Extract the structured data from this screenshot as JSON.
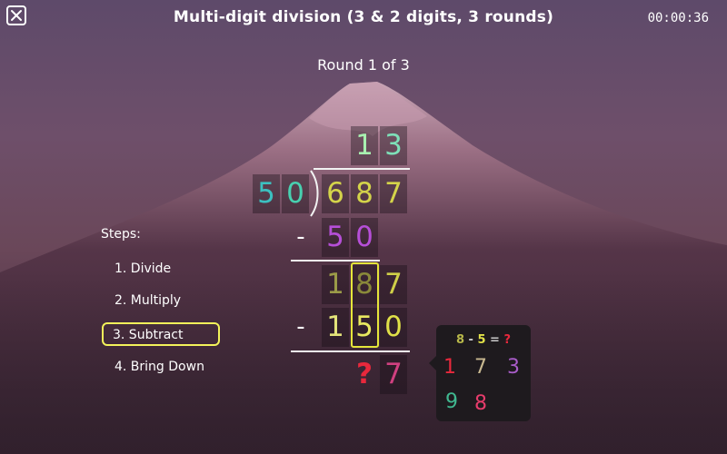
{
  "header": {
    "title": "Multi-digit division (3 & 2 digits, 3 rounds)",
    "timer": "00:00:36"
  },
  "round_label": "Round 1 of 3",
  "steps": {
    "title": "Steps:",
    "items": [
      "1. Divide",
      "2. Multiply",
      "3. Subtract",
      "4. Bring Down"
    ],
    "active_index": 2
  },
  "problem": {
    "quotient": [
      "1",
      "3"
    ],
    "divisor": [
      "5",
      "0"
    ],
    "dividend": [
      "6",
      "8",
      "7"
    ],
    "row1_minus": "-",
    "row1": [
      "5",
      "0"
    ],
    "row2": [
      "1",
      "8",
      "7"
    ],
    "row3_minus": "-",
    "row3": [
      "1",
      "5",
      "0"
    ],
    "row4": [
      "?",
      "7"
    ]
  },
  "popover": {
    "eq_a": "8",
    "eq_minus": "-",
    "eq_b": "5",
    "eq_equals": "=",
    "eq_q": "?",
    "options": [
      "1",
      "7",
      "3",
      "9",
      "8"
    ]
  },
  "colors": {
    "quotient_1": "#a8f0b0",
    "quotient_3": "#7ee0b8",
    "divisor_5": "#3cc0c0",
    "divisor_0": "#48d0b0",
    "dividend": "#d4d44a",
    "sub1": "#b64fd8",
    "row2_1": "#9b9b48",
    "row2_8": "#8a8a3a",
    "row2_7": "#cfcf48",
    "row3_1": "#e4e47a",
    "row3_5": "#e8e860",
    "row3_0": "#e0e048",
    "question": "#e8283c",
    "row4_7": "#d04080",
    "opt_1": "#e8283c",
    "opt_7": "#c8b890",
    "opt_3": "#a85cc8",
    "opt_9": "#40b890",
    "opt_8": "#e83c6c",
    "active_step": "#f3f35a"
  }
}
